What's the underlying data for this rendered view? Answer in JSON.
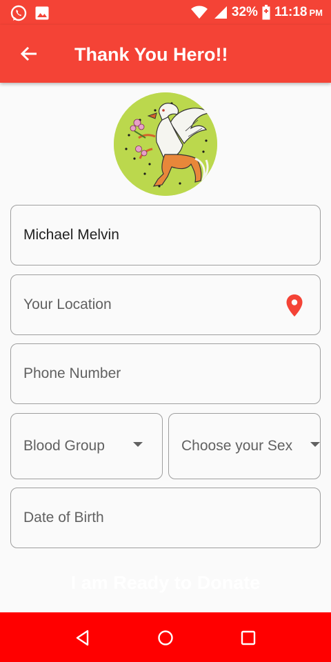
{
  "status_bar": {
    "battery": "32%",
    "time": "11:18",
    "ampm": "PM",
    "left_icons": [
      "whatsapp-icon",
      "gallery-icon"
    ],
    "right_icons": [
      "wifi-icon",
      "signal-icon",
      "battery-charging-icon"
    ]
  },
  "app_bar": {
    "title": "Thank You Hero!!",
    "back_icon": "arrow-back-icon"
  },
  "form": {
    "name_value": "Michael Melvin",
    "location_placeholder": "Your Location",
    "phone_placeholder": "Phone Number",
    "blood_group_placeholder": "Blood Group",
    "sex_placeholder": "Choose your Sex",
    "dob_placeholder": "Date of Birth"
  },
  "donate_button": "I am Ready to Donate",
  "colors": {
    "app_bar": "#f44336",
    "nav_bar": "#ff0000",
    "pin": "#f44336",
    "field_border": "#9e9e9e"
  },
  "nav": {
    "icons": [
      "back-triangle-icon",
      "home-circle-icon",
      "recents-square-icon"
    ]
  }
}
